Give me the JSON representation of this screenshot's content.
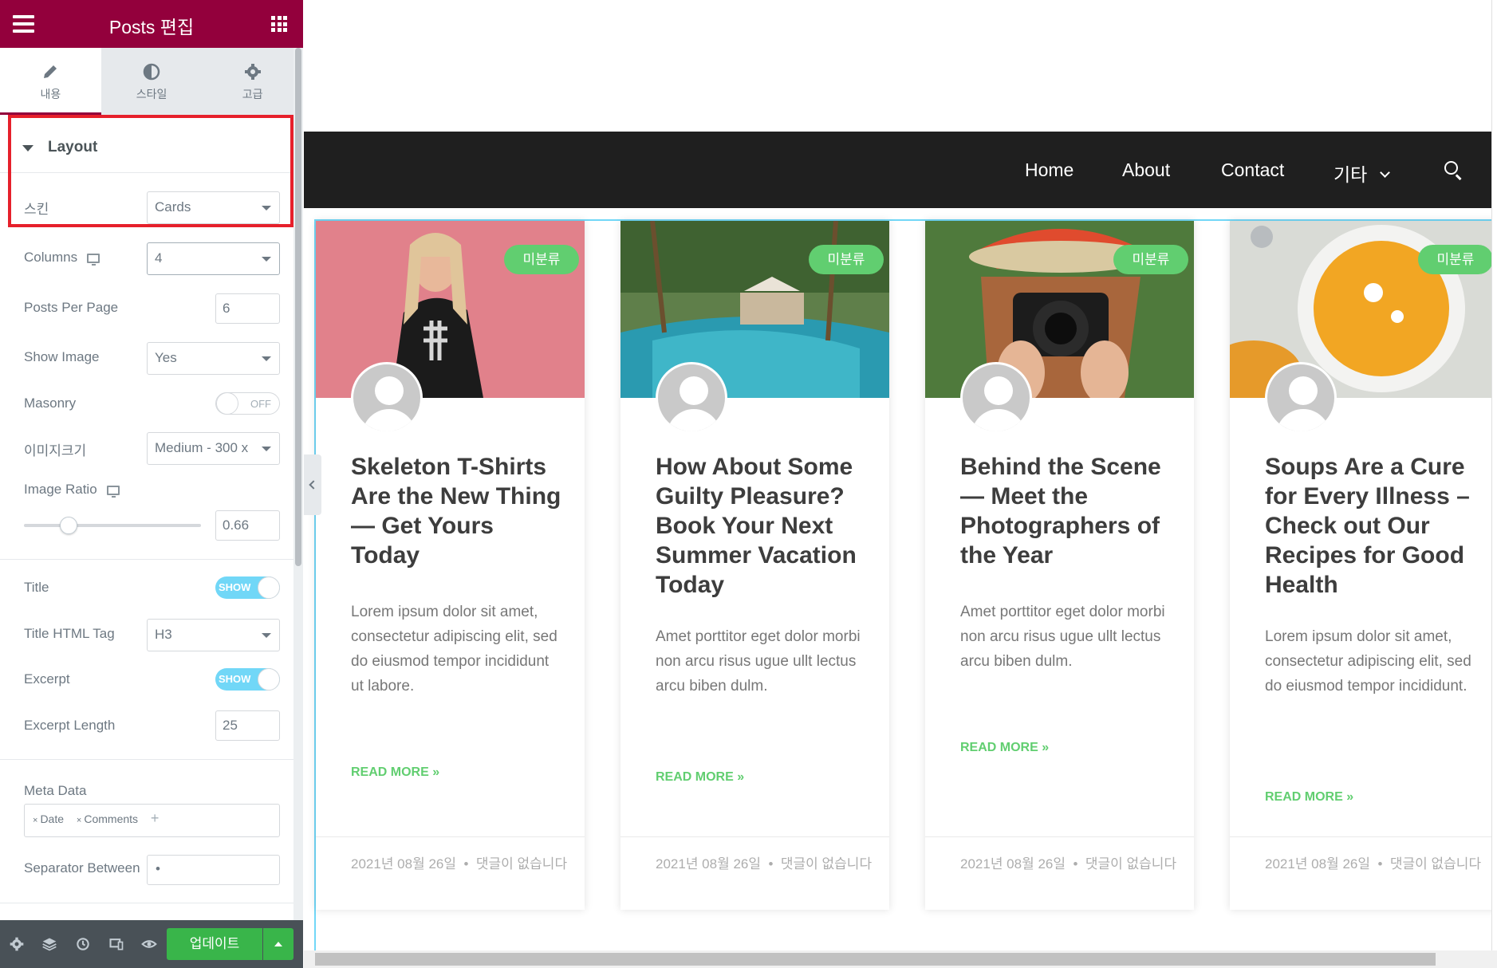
{
  "panel": {
    "title": "Posts 편집",
    "tabs": [
      {
        "label": "내용",
        "icon": "pencil-icon"
      },
      {
        "label": "스타일",
        "icon": "contrast-icon"
      },
      {
        "label": "고급",
        "icon": "gear-icon"
      }
    ],
    "section_title": "Layout",
    "controls": {
      "skin": {
        "label": "스킨",
        "value": "Cards"
      },
      "columns": {
        "label": "Columns",
        "value": "4"
      },
      "posts_per_page": {
        "label": "Posts Per Page",
        "value": "6"
      },
      "show_image": {
        "label": "Show Image",
        "value": "Yes"
      },
      "masonry": {
        "label": "Masonry",
        "state": "OFF"
      },
      "image_size": {
        "label": "이미지크기",
        "value": "Medium - 300 x"
      },
      "image_ratio": {
        "label": "Image Ratio",
        "value": "0.66",
        "slider_fraction": 0.25
      },
      "title": {
        "label": "Title",
        "state": "SHOW"
      },
      "title_html_tag": {
        "label": "Title HTML Tag",
        "value": "H3"
      },
      "excerpt": {
        "label": "Excerpt",
        "state": "SHOW"
      },
      "excerpt_length": {
        "label": "Excerpt Length",
        "value": "25"
      },
      "meta_data": {
        "label": "Meta Data",
        "chips": [
          "Date",
          "Comments"
        ],
        "add": "+"
      },
      "separator_between": {
        "label": "Separator Between",
        "value": "•"
      }
    },
    "footer": {
      "icons": [
        "settings-icon",
        "layers-icon",
        "history-icon",
        "responsive-icon",
        "eye-icon"
      ],
      "update_label": "업데이트"
    }
  },
  "site": {
    "nav": [
      {
        "label": "Home"
      },
      {
        "label": "About"
      },
      {
        "label": "Contact"
      },
      {
        "label": "기타"
      }
    ],
    "posts": [
      {
        "category": "미분류",
        "title": "Skeleton T-Shirts Are the New Thing — Get Yours Today",
        "excerpt": "Lorem ipsum dolor sit amet, consectetur adipiscing elit, sed do eiusmod tempor incididunt ut labore.",
        "read_more": "READ MORE »",
        "date": "2021년 08월 26일",
        "separator": "•",
        "comments": "댓글이 없습니다"
      },
      {
        "category": "미분류",
        "title": "How About Some Guilty Pleasure? Book Your Next Summer Vacation Today",
        "excerpt": "Amet porttitor eget dolor morbi non arcu risus ugue ullt lectus arcu biben dulm.",
        "read_more": "READ MORE »",
        "date": "2021년 08월 26일",
        "separator": "•",
        "comments": "댓글이 없습니다"
      },
      {
        "category": "미분류",
        "title": "Behind the Scene — Meet the Photographers of the Year",
        "excerpt": "Amet porttitor eget dolor morbi non arcu risus ugue ullt lectus arcu biben dulm.",
        "read_more": "READ MORE »",
        "date": "2021년 08월 26일",
        "separator": "•",
        "comments": "댓글이 없습니다"
      },
      {
        "category": "미분류",
        "title": "Soups Are a Cure for Every Illness – Check out Our Recipes for Good Health",
        "excerpt": "Lorem ipsum dolor sit amet, consectetur adipiscing elit, sed do eiusmod tempor incididunt.",
        "read_more": "READ MORE »",
        "date": "2021년 08월 26일",
        "separator": "•",
        "comments": "댓글이 없습니다"
      }
    ]
  },
  "colors": {
    "brand": "#93003c",
    "accent_green": "#61ce70",
    "update_green": "#39b54a",
    "nav_bg": "#1f1f1f",
    "highlight_red": "#e6202b"
  }
}
